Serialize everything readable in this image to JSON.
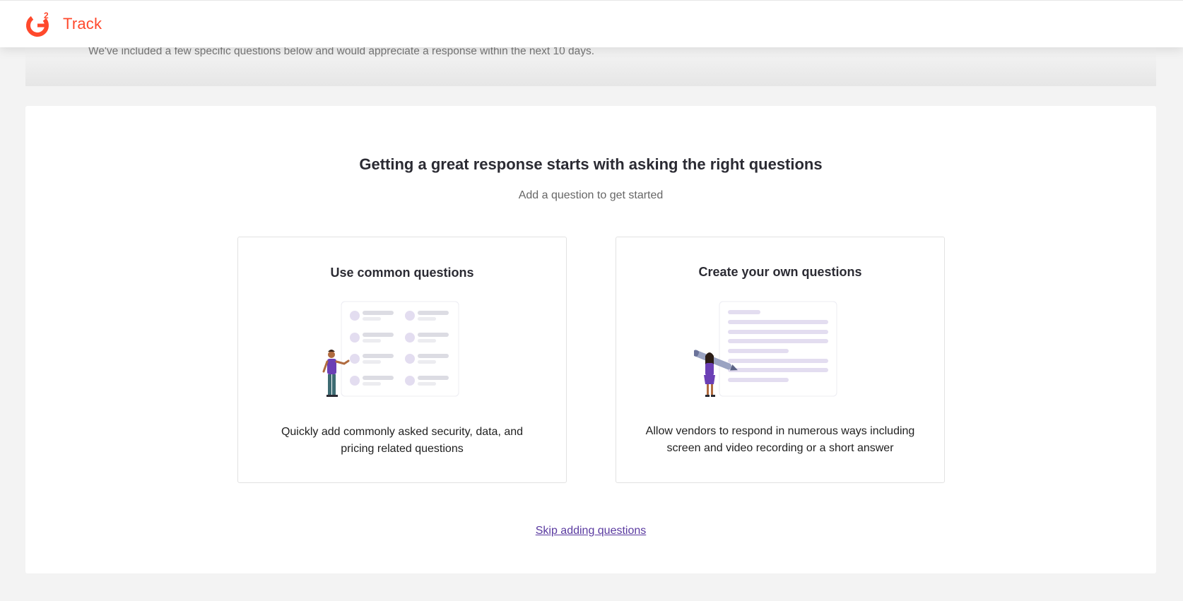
{
  "header": {
    "brand": "Track",
    "logo_icon": "g2-logo-icon",
    "brand_color": "#ff492c"
  },
  "intro": {
    "text": "We've included a few specific questions below and would appreciate a response within the next 10 days."
  },
  "main": {
    "title": "Getting a great response starts with asking the right questions",
    "subtitle": "Add a question to get started",
    "cards": [
      {
        "title": "Use common questions",
        "description": "Quickly add commonly asked security, data, and pricing related questions",
        "illustration": "question-list-illustration-icon"
      },
      {
        "title": "Create your own questions",
        "description": "Allow vendors to respond in numerous ways including screen and video recording or a short answer",
        "illustration": "pen-writing-illustration-icon"
      }
    ],
    "skip_link": "Skip adding questions",
    "accent_color": "#5a3aa0"
  }
}
